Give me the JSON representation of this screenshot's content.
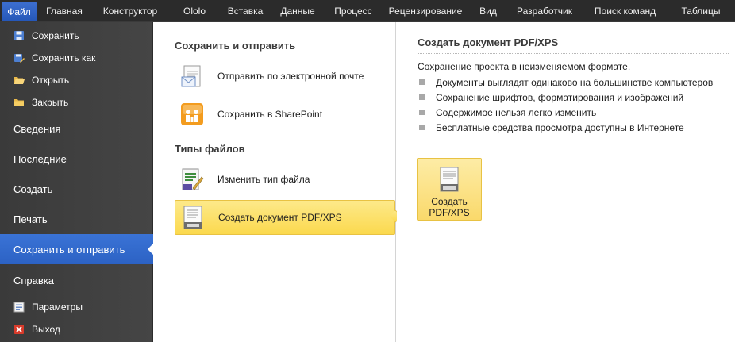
{
  "ribbon": {
    "tabs": [
      {
        "label": "Файл",
        "name": "tab-file"
      },
      {
        "label": "Главная",
        "name": "tab-home"
      },
      {
        "label": "Конструктор",
        "name": "tab-designer"
      },
      {
        "label": "Ololo",
        "name": "tab-ololo"
      },
      {
        "label": "Вставка",
        "name": "tab-insert"
      },
      {
        "label": "Данные",
        "name": "tab-data"
      },
      {
        "label": "Процесс",
        "name": "tab-process"
      },
      {
        "label": "Рецензирование",
        "name": "tab-review"
      },
      {
        "label": "Вид",
        "name": "tab-view"
      },
      {
        "label": "Разработчик",
        "name": "tab-developer"
      },
      {
        "label": "Поиск команд",
        "name": "tab-search-commands"
      },
      {
        "label": "Таблицы",
        "name": "tab-tables"
      }
    ]
  },
  "nav": {
    "save": "Сохранить",
    "save_as": "Сохранить как",
    "open": "Открыть",
    "close": "Закрыть",
    "info": "Сведения",
    "recent": "Последние",
    "new": "Создать",
    "print": "Печать",
    "save_send": "Сохранить и отправить",
    "help": "Справка",
    "options": "Параметры",
    "exit": "Выход"
  },
  "middle": {
    "save_send_header": "Сохранить и отправить",
    "send_email": "Отправить по электронной почте",
    "save_sharepoint": "Сохранить в SharePoint",
    "file_types_header": "Типы файлов",
    "change_file_type": "Изменить тип файла",
    "create_pdf": "Создать документ PDF/XPS"
  },
  "right": {
    "title": "Создать документ PDF/XPS",
    "description": "Сохранение проекта в неизменяемом формате.",
    "bullets": [
      "Документы выглядят одинаково на большинстве компьютеров",
      "Сохранение шрифтов, форматирования и изображений",
      "Содержимое нельзя легко изменить",
      "Бесплатные средства просмотра доступны в Интернете"
    ],
    "button_label": "Создать\nPDF/XPS"
  },
  "colors": {
    "ribbon_bg": "#2b2b2b",
    "nav_bg": "#404040",
    "accent_blue": "#2c62c4",
    "selection_yellow": "#fbd94e"
  }
}
